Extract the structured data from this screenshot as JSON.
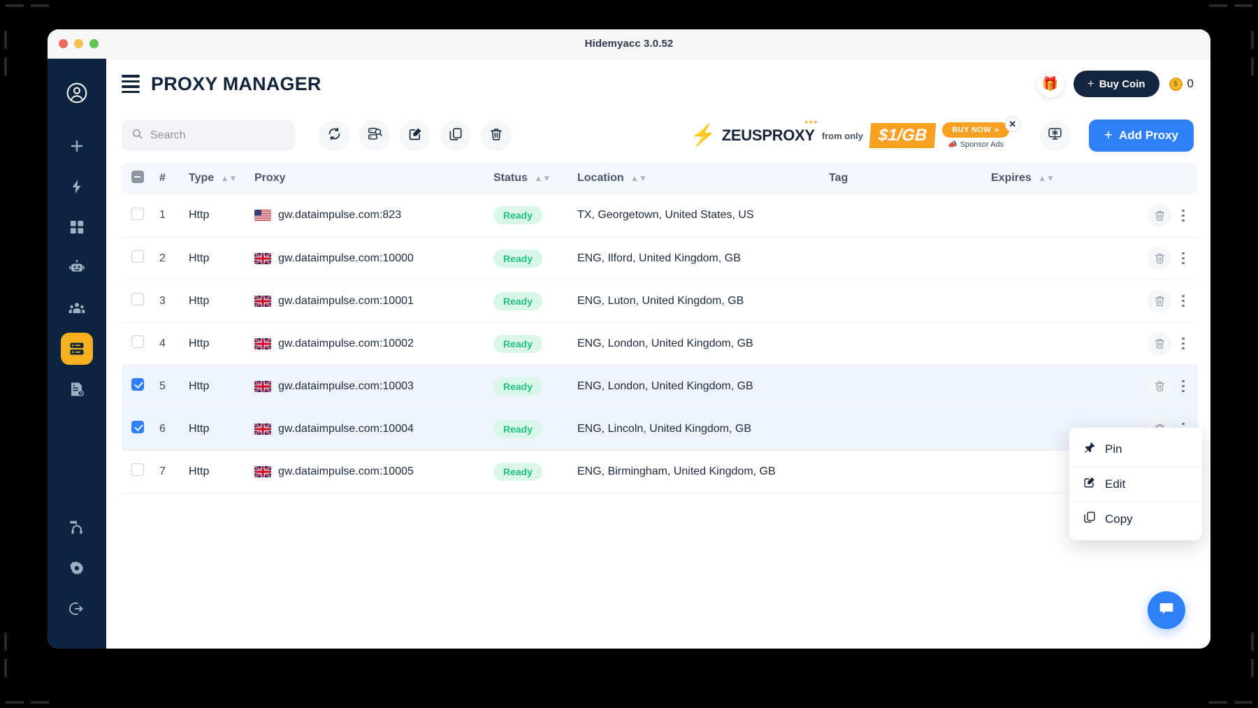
{
  "window": {
    "title": "Hidemyacc 3.0.52",
    "traffic_lights": [
      "close",
      "minimize",
      "maximize"
    ]
  },
  "sidebar": {
    "items": [
      {
        "name": "account",
        "icon": "user-circle-icon",
        "active": false
      },
      {
        "name": "new-profile",
        "icon": "plus-icon",
        "active": false
      },
      {
        "name": "quick-launch",
        "icon": "lightning-icon",
        "active": false
      },
      {
        "name": "profiles",
        "icon": "grid-icon",
        "active": false
      },
      {
        "name": "automation",
        "icon": "robot-icon",
        "active": false
      },
      {
        "name": "team",
        "icon": "people-icon",
        "active": false
      },
      {
        "name": "proxy-manager",
        "icon": "server-icon",
        "active": true
      },
      {
        "name": "logs",
        "icon": "document-clock-icon",
        "active": false
      }
    ],
    "bottom_items": [
      {
        "name": "support",
        "icon": "headset-icon"
      },
      {
        "name": "settings",
        "icon": "gear-icon"
      },
      {
        "name": "logout",
        "icon": "logout-icon"
      }
    ],
    "active_color": "#f5b01f",
    "background": "#0d2440"
  },
  "header": {
    "title": "PROXY MANAGER",
    "menu_icon": "hamburger-icon",
    "gift_icon": "gift-icon",
    "buy_coin_label": "Buy Coin",
    "buy_coin_plus": "+",
    "coin_count": "0",
    "coin_symbol": "$"
  },
  "toolbar": {
    "search_placeholder": "Search",
    "search_value": "",
    "buttons": [
      {
        "name": "refresh-button",
        "icon": "refresh-icon"
      },
      {
        "name": "check-proxy-button",
        "icon": "proxy-check-icon"
      },
      {
        "name": "edit-button",
        "icon": "edit-icon"
      },
      {
        "name": "copy-button",
        "icon": "copy-icon"
      },
      {
        "name": "delete-button",
        "icon": "trash-icon"
      }
    ],
    "settings_icon": "monitor-settings-icon",
    "add_proxy_label": "Add Proxy",
    "add_proxy_plus": "+",
    "add_proxy_color": "#2f80f7"
  },
  "ad": {
    "brand": "ZEUSPROXY",
    "from_only": "from only",
    "price": "$1/GB",
    "cta": "BUY NOW",
    "cta_arrow": "»",
    "sponsor": "Sponsor Ads",
    "close_label": "✕",
    "accent": "#f7a022"
  },
  "table": {
    "columns": [
      {
        "key": "checkbox",
        "label": "",
        "sortable": false
      },
      {
        "key": "num",
        "label": "#",
        "sortable": false
      },
      {
        "key": "type",
        "label": "Type",
        "sortable": true
      },
      {
        "key": "proxy",
        "label": "Proxy",
        "sortable": false
      },
      {
        "key": "status",
        "label": "Status",
        "sortable": true
      },
      {
        "key": "location",
        "label": "Location",
        "sortable": true
      },
      {
        "key": "tag",
        "label": "Tag",
        "sortable": false
      },
      {
        "key": "expires",
        "label": "Expires",
        "sortable": true
      },
      {
        "key": "actions",
        "label": "",
        "sortable": false
      }
    ],
    "header_select_state": "indeterminate",
    "rows": [
      {
        "num": "1",
        "type": "Http",
        "flag": "us",
        "proxy": "gw.dataimpulse.com:823",
        "status": "Ready",
        "location": "TX, Georgetown, United States, US",
        "tag": "",
        "expires": "",
        "selected": false
      },
      {
        "num": "2",
        "type": "Http",
        "flag": "gb",
        "proxy": "gw.dataimpulse.com:10000",
        "status": "Ready",
        "location": "ENG, Ilford, United Kingdom, GB",
        "tag": "",
        "expires": "",
        "selected": false
      },
      {
        "num": "3",
        "type": "Http",
        "flag": "gb",
        "proxy": "gw.dataimpulse.com:10001",
        "status": "Ready",
        "location": "ENG, Luton, United Kingdom, GB",
        "tag": "",
        "expires": "",
        "selected": false
      },
      {
        "num": "4",
        "type": "Http",
        "flag": "gb",
        "proxy": "gw.dataimpulse.com:10002",
        "status": "Ready",
        "location": "ENG, London, United Kingdom, GB",
        "tag": "",
        "expires": "",
        "selected": false
      },
      {
        "num": "5",
        "type": "Http",
        "flag": "gb",
        "proxy": "gw.dataimpulse.com:10003",
        "status": "Ready",
        "location": "ENG, London, United Kingdom, GB",
        "tag": "",
        "expires": "",
        "selected": true
      },
      {
        "num": "6",
        "type": "Http",
        "flag": "gb",
        "proxy": "gw.dataimpulse.com:10004",
        "status": "Ready",
        "location": "ENG, Lincoln, United Kingdom, GB",
        "tag": "",
        "expires": "",
        "selected": true
      },
      {
        "num": "7",
        "type": "Http",
        "flag": "gb",
        "proxy": "gw.dataimpulse.com:10005",
        "status": "Ready",
        "location": "ENG, Birmingham, United Kingdom, GB",
        "tag": "",
        "expires": "",
        "selected": false
      }
    ],
    "status_colors": {
      "ready_text": "#22c08a",
      "ready_bg": "#d9f7e9"
    },
    "selected_row_bg": "#eef3fc",
    "header_bg": "#f4f8fd"
  },
  "context_menu": {
    "visible": true,
    "items": [
      {
        "label": "Pin",
        "icon": "pin-icon"
      },
      {
        "label": "Edit",
        "icon": "edit-square-icon"
      },
      {
        "label": "Copy",
        "icon": "copy-icon"
      }
    ]
  },
  "chat": {
    "icon": "chat-bubble-icon",
    "color": "#2f80f7"
  }
}
